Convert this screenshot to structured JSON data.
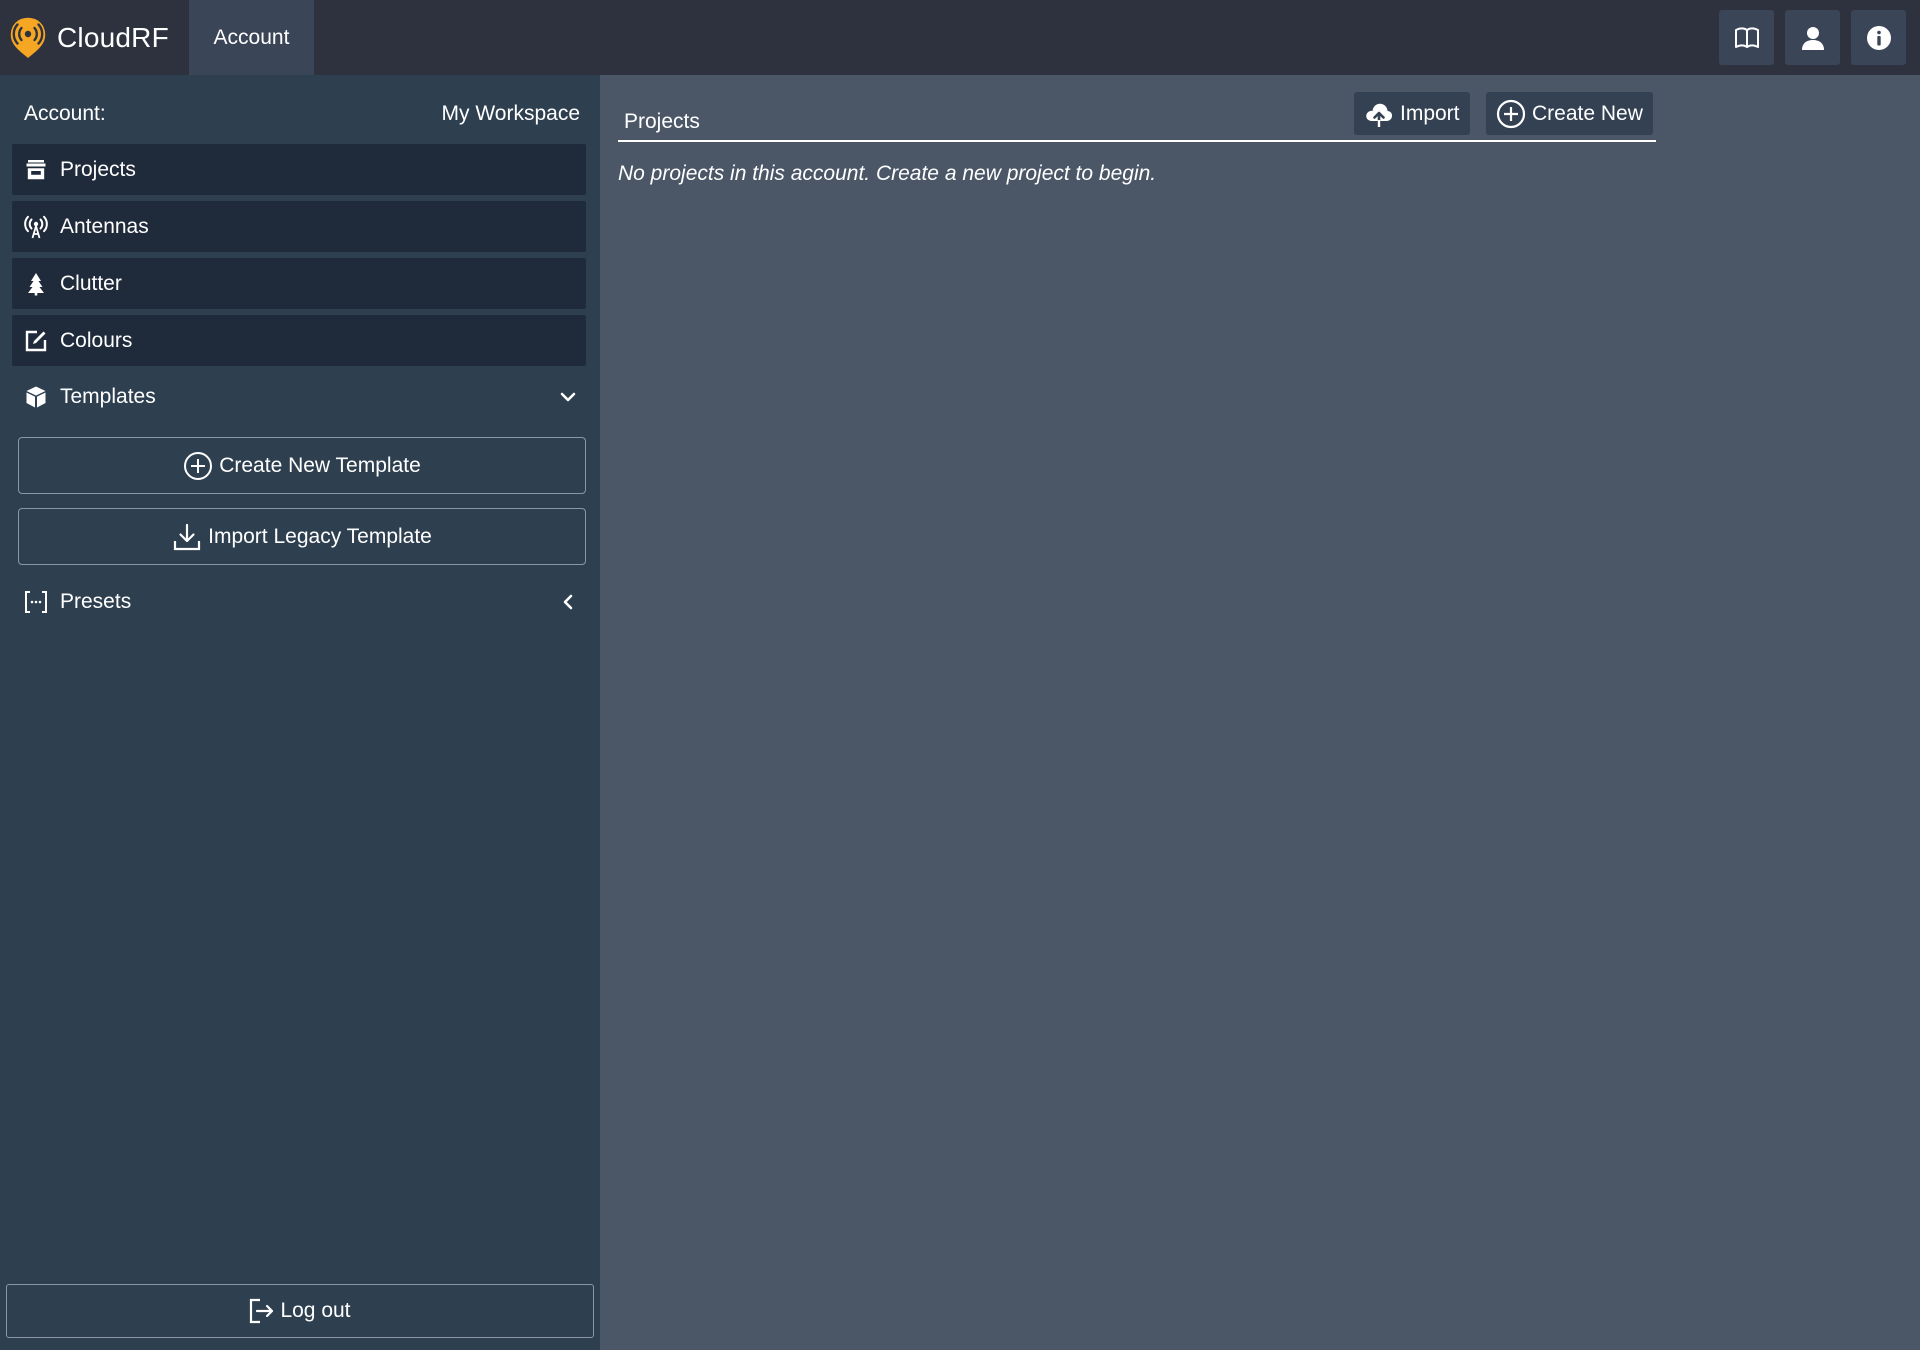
{
  "app": {
    "name": "CloudRF",
    "active_tab": "Account",
    "logo_icon": "cloudrf-logo-icon",
    "accent_color": "#f5a623"
  },
  "topbar": {
    "icons": [
      "book-icon",
      "user-icon",
      "info-icon"
    ]
  },
  "sidebar": {
    "account_label": "Account:",
    "workspace_name": "My Workspace",
    "items": [
      {
        "label": "Projects",
        "icon": "archive-box-icon"
      },
      {
        "label": "Antennas",
        "icon": "broadcast-antenna-icon"
      },
      {
        "label": "Clutter",
        "icon": "tree-icon"
      },
      {
        "label": "Colours",
        "icon": "edit-square-icon"
      }
    ],
    "templates": {
      "label": "Templates",
      "icon": "cube-icon",
      "expanded": true,
      "create_label": "Create New Template",
      "import_label": "Import Legacy Template"
    },
    "presets": {
      "label": "Presets",
      "icon": "brackets-ellipsis-icon",
      "expanded": false
    },
    "logout_label": "Log out"
  },
  "main": {
    "title": "Projects",
    "import_label": "Import",
    "create_label": "Create New",
    "empty_message": "No projects in this account. Create a new project to begin."
  },
  "colors": {
    "topbar": "#2e323f",
    "sidebar": "#2e3f50",
    "nav_item": "#1f2a3a",
    "main": "#4b5767"
  }
}
